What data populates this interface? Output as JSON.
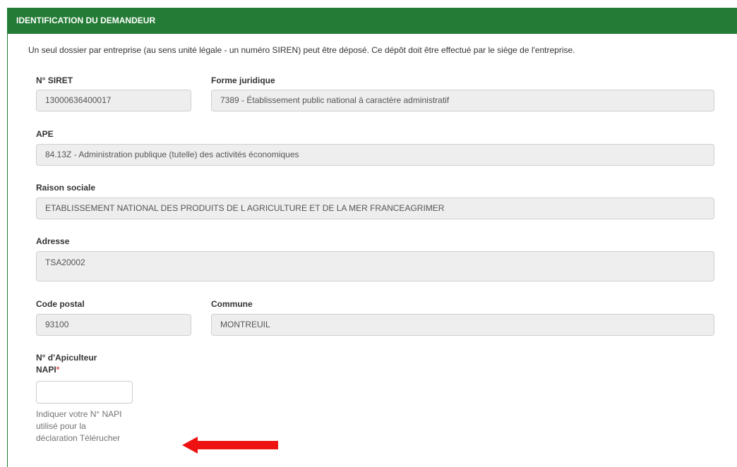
{
  "panel": {
    "title": "IDENTIFICATION DU DEMANDEUR",
    "intro": "Un seul dossier par entreprise (au sens unité légale - un numéro SIREN) peut être déposé. Ce dépôt doit être effectué par le siège de l'entreprise."
  },
  "fields": {
    "siret": {
      "label": "N° SIRET",
      "value": "13000636400017"
    },
    "forme_juridique": {
      "label": "Forme juridique",
      "value": "7389 - Établissement public national à caractère administratif"
    },
    "ape": {
      "label": "APE",
      "value": "84.13Z - Administration publique (tutelle) des activités économiques"
    },
    "raison_sociale": {
      "label": "Raison sociale",
      "value": "ETABLISSEMENT NATIONAL DES PRODUITS DE L AGRICULTURE ET DE LA MER FRANCEAGRIMER"
    },
    "adresse": {
      "label": "Adresse",
      "value": "TSA20002"
    },
    "code_postal": {
      "label": "Code postal",
      "value": "93100"
    },
    "commune": {
      "label": "Commune",
      "value": "MONTREUIL"
    },
    "napi": {
      "label_line1": "N° d'Apiculteur",
      "label_line2": "NAPI",
      "required_mark": "*",
      "value": "",
      "help_line1": "Indiquer votre N° NAPI",
      "help_line2": "utilisé pour la",
      "help_line3": "déclaration Télérucher"
    }
  },
  "colors": {
    "header_bg": "#237b35",
    "readonly_bg": "#eeeeee",
    "required": "#d9534f",
    "arrow": "#ee1111"
  },
  "icons": {
    "annotation": "left-arrow"
  }
}
